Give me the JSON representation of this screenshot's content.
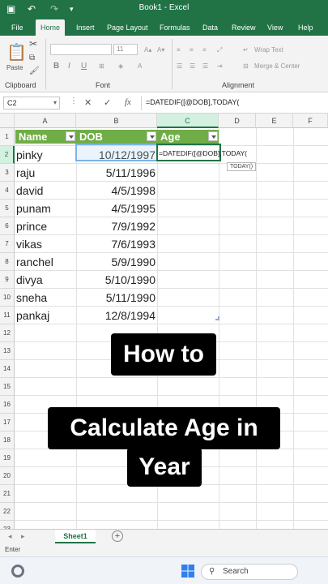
{
  "titlebar": {
    "title": "Book1 - Excel"
  },
  "menu": {
    "tabs": [
      "File",
      "Home",
      "Insert",
      "Page Layout",
      "Formulas",
      "Data",
      "Review",
      "View",
      "Help"
    ],
    "active": "Home"
  },
  "ribbon": {
    "paste": "Paste",
    "clipboard_label": "Clipboard",
    "font_label": "Font",
    "font_size": "11",
    "bold": "B",
    "italic": "I",
    "underline": "U",
    "alignment_label": "Alignment",
    "wrap_text": "Wrap Text",
    "merge_center": "Merge & Center"
  },
  "formula_bar": {
    "name_box": "C2",
    "cancel": "✕",
    "enter": "✓",
    "fx": "fx",
    "formula": "=DATEDIF([@DOB],TODAY("
  },
  "grid": {
    "columns": [
      "A",
      "B",
      "C",
      "D",
      "E",
      "F"
    ],
    "rows": [
      "1",
      "2",
      "3",
      "4",
      "5",
      "6",
      "7",
      "8",
      "9",
      "10",
      "11",
      "12",
      "13",
      "14",
      "15",
      "16",
      "17",
      "18",
      "19",
      "20",
      "21",
      "22",
      "23"
    ],
    "table_headers": [
      "Name",
      "DOB",
      "Age"
    ],
    "table_rows": [
      {
        "name": "pinky",
        "dob": "10/12/1997"
      },
      {
        "name": "raju",
        "dob": "5/11/1996"
      },
      {
        "name": "david",
        "dob": "4/5/1998"
      },
      {
        "name": "punam",
        "dob": "4/5/1995"
      },
      {
        "name": "prince",
        "dob": "7/9/1992"
      },
      {
        "name": "vikas",
        "dob": "7/6/1993"
      },
      {
        "name": "ranchel",
        "dob": "5/9/1990"
      },
      {
        "name": "divya",
        "dob": "5/10/1990"
      },
      {
        "name": "sneha",
        "dob": "5/11/1990"
      },
      {
        "name": "pankaj",
        "dob": "12/8/1994"
      }
    ],
    "editing_formula": "=DATEDIF([@DOB],TODAY(",
    "tooltip": "TODAY()"
  },
  "overlay": {
    "line1": "How to",
    "line2": "Calculate  Age in",
    "line3": "Year"
  },
  "sheets": {
    "active": "Sheet1",
    "add": "+"
  },
  "status": {
    "mode": "Enter"
  },
  "taskbar": {
    "search": "Search"
  }
}
